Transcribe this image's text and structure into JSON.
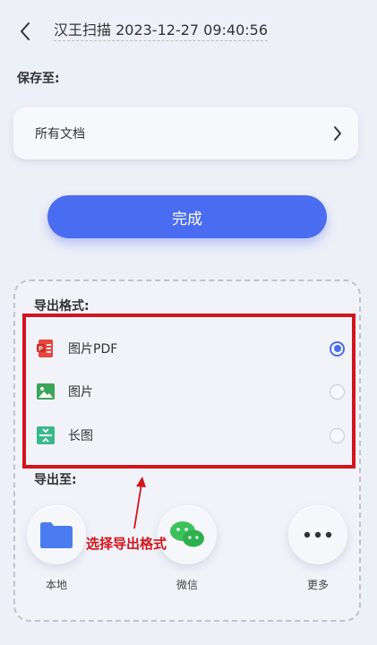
{
  "header": {
    "back_icon": "chevron-left-icon",
    "title": "汉王扫描 2023-12-27 09:40:56"
  },
  "save": {
    "label": "保存至:",
    "folder": "所有文档",
    "chevron_icon": "chevron-right-icon"
  },
  "done_button": "完成",
  "export_format": {
    "label": "导出格式:",
    "options": [
      {
        "label": "图片PDF",
        "icon": "pdf-icon",
        "checked": true,
        "color": "#e8453c"
      },
      {
        "label": "图片",
        "icon": "image-icon",
        "checked": false,
        "color": "#3aa657"
      },
      {
        "label": "长图",
        "icon": "long-image-icon",
        "checked": false,
        "color": "#39b98a"
      }
    ]
  },
  "export_to": {
    "label": "导出至:",
    "destinations": [
      {
        "label": "本地",
        "icon": "folder-icon"
      },
      {
        "label": "微信",
        "icon": "wechat-icon"
      },
      {
        "label": "更多",
        "icon": "more-icon"
      }
    ]
  },
  "annotation": {
    "text": "选择导出格式",
    "color": "#d4141c"
  },
  "colors": {
    "accent": "#4a6cf0",
    "background": "#eef0f7",
    "annotation_red": "#d4141c"
  }
}
